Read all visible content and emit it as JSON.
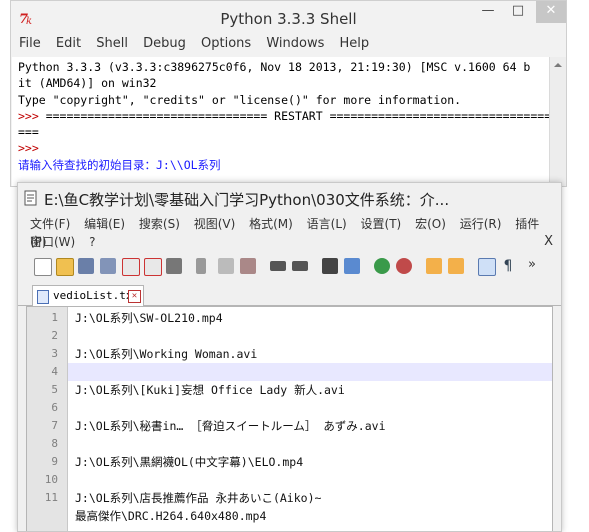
{
  "shell": {
    "title": "Python 3.3.3 Shell",
    "window_controls": {
      "minimize": "—",
      "maximize": "□",
      "close": "✕"
    },
    "menu": [
      "File",
      "Edit",
      "Shell",
      "Debug",
      "Options",
      "Windows",
      "Help"
    ],
    "lines": [
      {
        "text": "Python 3.3.3 (v3.3.3:c3896275c0f6, Nov 18 2013, 21:19:30) [MSC v.1600 64 b"
      },
      {
        "text": "it (AMD64)] on win32"
      },
      {
        "text": "Type \"copyright\", \"credits\" or \"license()\" for more information."
      },
      {
        "prompt": ">>> ",
        "text": "================================ RESTART ================================"
      },
      {
        "text": "==="
      },
      {
        "prompt": ">>> ",
        "text": ""
      },
      {
        "text": "请输入待查找的初始目录：J:\\\\OL系列"
      }
    ]
  },
  "editor": {
    "title": "E:\\鱼C教学计划\\零基础入门学习Python\\030文件系统：介...",
    "menu_row1": [
      "文件(F)",
      "编辑(E)",
      "搜索(S)",
      "视图(V)",
      "格式(M)",
      "语言(L)",
      "设置(T)",
      "宏(O)",
      "运行(R)",
      "插件(P)"
    ],
    "menu_row2": [
      "窗口(W)",
      "?"
    ],
    "close_x": "X",
    "toolbar_more": "»",
    "tab_label": "vedioList.txt",
    "lines": [
      {
        "num": "1",
        "text": "J:\\OL系列\\SW-OL210.mp4"
      },
      {
        "num": "2",
        "text": ""
      },
      {
        "num": "3",
        "text": "J:\\OL系列\\Working Woman.avi"
      },
      {
        "num": "4",
        "text": ""
      },
      {
        "num": "5",
        "text": "J:\\OL系列\\[Kuki]妄想 Office Lady 新人.avi"
      },
      {
        "num": "6",
        "text": ""
      },
      {
        "num": "7",
        "text": "J:\\OL系列\\秘書in… ［脅迫スイートルーム］ あずみ.avi"
      },
      {
        "num": "8",
        "text": ""
      },
      {
        "num": "9",
        "text": "J:\\OL系列\\黒網襪OL(中文字幕)\\ELO.mp4"
      },
      {
        "num": "10",
        "text": ""
      },
      {
        "num": "11",
        "text": "J:\\OL系列\\店長推薦作品 永井あいこ(Aiko)~"
      },
      {
        "num": "",
        "text": "最高傑作\\DRC.H264.640x480.mp4"
      }
    ]
  }
}
